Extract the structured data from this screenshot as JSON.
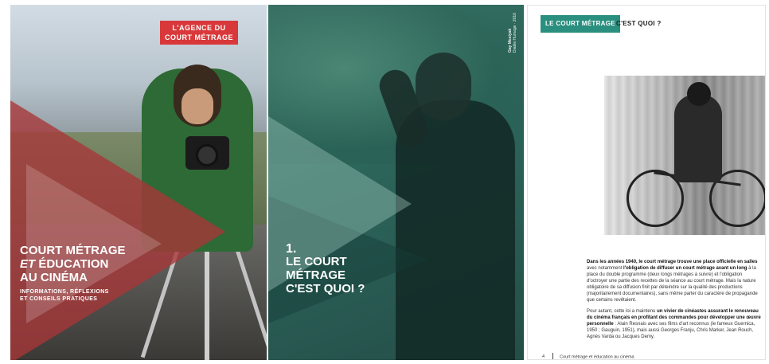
{
  "cover": {
    "badge_line1": "L'AGENCE DU",
    "badge_line2": "COURT MÉTRAGE",
    "title_line1": "COURT MÉTRAGE",
    "title_line2_em": "ET",
    "title_line2_rest": " ÉDUCATION",
    "title_line3": "AU CINÉMA",
    "subtitle_line1": "INFORMATIONS, RÉFLEXIONS",
    "subtitle_line2": "ET CONSEILS PRATIQUES"
  },
  "chapter": {
    "credit_name": "Gay Mesiyak",
    "credit_film": "Diable Humage · 2016",
    "number": "1.",
    "heading_line1": "LE COURT",
    "heading_line2": "MÉTRAGE",
    "heading_line3": "C'EST QUOI ?"
  },
  "article": {
    "header_highlight": "LE COURT MÉTRAGE",
    "header_rest": "C'EST QUOI ?",
    "p1_b1": "Dans les années 1940, le court métrage trouve une place officielle en salles",
    "p1_t1": " avec notamment ",
    "p1_b2": "l'obligation de diffuser un court métrage avant un long",
    "p1_t2": " à la place du double programme (deux longs métrages à suivre) et l'obligation d'octroyer une partie des recettes de la séance au court métrage. Mais la nature obligatoire de sa diffusion finit par déteindre sur la qualité des productions (majoritairement documentaires), sans même parler du caractère de propagande que certains revêtaient.",
    "p2_t1": "Pour autant, cette loi a maintenu ",
    "p2_b1": "un vivier de cinéastes assurant le renouveau du cinéma français en profitant des commandes pour développer une œuvre personnelle",
    "p2_t2": " : Alain Resnais avec ses films d'art reconnus (le fameux Guernica, 1950 ; Gauguin, 1951), mais aussi Georges Franju, Chris Marker, Jean Rouch, Agnès Varda ou Jacques Demy.",
    "page_number": "4",
    "footer_text": "Court métrage et éducation au cinéma"
  }
}
